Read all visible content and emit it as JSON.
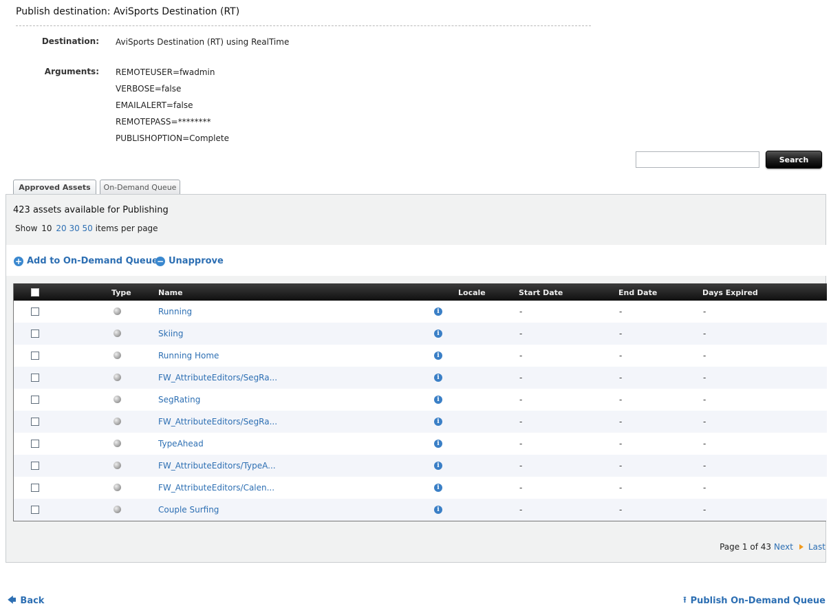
{
  "header": {
    "title": "Publish destination: AviSports Destination (RT)"
  },
  "details": {
    "destination_label": "Destination:",
    "destination_value": "AviSports Destination (RT) using RealTime",
    "arguments_label": "Arguments:",
    "arguments": [
      "REMOTEUSER=fwadmin",
      "VERBOSE=false",
      "EMAILALERT=false",
      "REMOTEPASS=********",
      "PUBLISHOPTION=Complete"
    ]
  },
  "search": {
    "value": "",
    "button_label": "Search"
  },
  "tabs": [
    {
      "label": "Approved Assets",
      "active": true
    },
    {
      "label": "On-Demand Queue",
      "active": false
    }
  ],
  "summary": {
    "asset_count_text": "423 assets available for Publishing",
    "show_label": "Show",
    "page_sizes": [
      "10",
      "20",
      "30",
      "50"
    ],
    "per_page_label": "items per page"
  },
  "actions": {
    "add_queue": "Add to On-Demand Queue",
    "unapprove": "Unapprove"
  },
  "table": {
    "columns": [
      "Type",
      "Name",
      "Locale",
      "Start Date",
      "End Date",
      "Days Expired"
    ],
    "rows": [
      {
        "name": "Running",
        "locale": "",
        "start": "-",
        "end": "-",
        "expired": "-"
      },
      {
        "name": "Skiing",
        "locale": "",
        "start": "-",
        "end": "-",
        "expired": "-"
      },
      {
        "name": "Running Home",
        "locale": "",
        "start": "-",
        "end": "-",
        "expired": "-"
      },
      {
        "name": "FW_AttributeEditors/SegRa...",
        "locale": "",
        "start": "-",
        "end": "-",
        "expired": "-"
      },
      {
        "name": "SegRating",
        "locale": "",
        "start": "-",
        "end": "-",
        "expired": "-"
      },
      {
        "name": "FW_AttributeEditors/SegRa...",
        "locale": "",
        "start": "-",
        "end": "-",
        "expired": "-"
      },
      {
        "name": "TypeAhead",
        "locale": "",
        "start": "-",
        "end": "-",
        "expired": "-"
      },
      {
        "name": "FW_AttributeEditors/TypeA...",
        "locale": "",
        "start": "-",
        "end": "-",
        "expired": "-"
      },
      {
        "name": "FW_AttributeEditors/Calen...",
        "locale": "",
        "start": "-",
        "end": "-",
        "expired": "-"
      },
      {
        "name": "Couple Surfing",
        "locale": "",
        "start": "-",
        "end": "-",
        "expired": "-"
      }
    ]
  },
  "pager": {
    "text": "Page 1 of 43",
    "next": "Next",
    "last": "Last"
  },
  "footer": {
    "back": "Back",
    "publish": "Publish On-Demand Queue"
  },
  "colors": {
    "link": "#2d6fb3",
    "header_bar": "#1a1a1a",
    "panel_bg": "#f1f2f2",
    "pager_arrow": "#f29a1c"
  },
  "icons": {
    "add": "plus-circle-icon",
    "unapprove": "minus-circle-icon",
    "info": "info-icon",
    "type": "asset-type-dot-icon",
    "back": "back-arrow-icon",
    "publish": "publish-upload-icon",
    "next": "arrow-right-icon"
  }
}
